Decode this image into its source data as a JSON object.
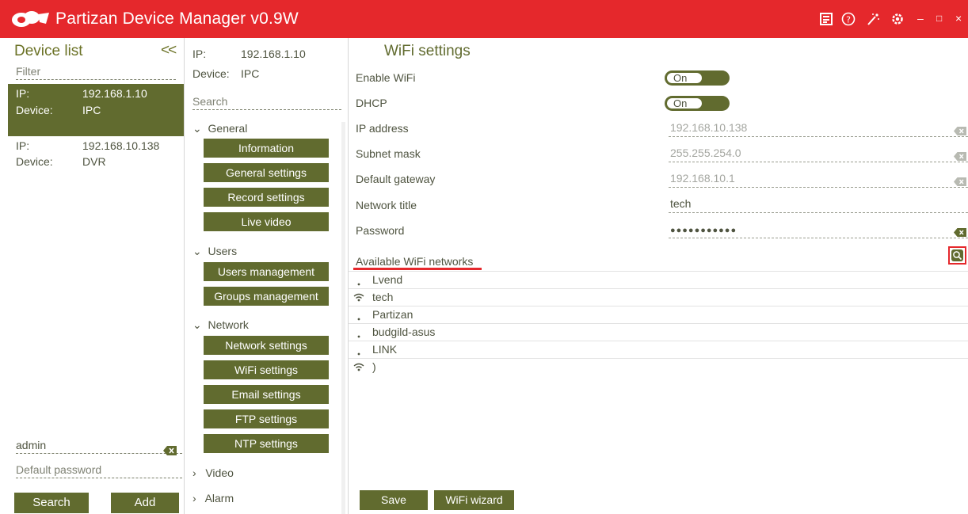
{
  "app": {
    "title": "Partizan Device Manager v0.9W",
    "brand_color": "#e5282c",
    "accent_color": "#616b2f",
    "titlebar_icons": [
      "book-icon",
      "help-icon",
      "wizard-wand-icon",
      "settings-gear-icon"
    ],
    "window_controls": [
      "minimize",
      "maximize",
      "close"
    ]
  },
  "device_list": {
    "title": "Device list",
    "collapse_glyph": "<<",
    "filter_placeholder": "Filter",
    "devices": [
      {
        "ip_label": "IP:",
        "ip": "192.168.1.10",
        "device_label": "Device:",
        "device": "IPC",
        "selected": true
      },
      {
        "ip_label": "IP:",
        "ip": "192.168.10.138",
        "device_label": "Device:",
        "device": "DVR",
        "selected": false
      }
    ],
    "username_value": "admin",
    "password_placeholder": "Default password",
    "search_button": "Search",
    "add_button": "Add"
  },
  "menu": {
    "ip_label": "IP:",
    "ip_value": "192.168.1.10",
    "device_label": "Device:",
    "device_value": "IPC",
    "search_placeholder": "Search",
    "sections": {
      "general": {
        "label": "General",
        "expanded": true,
        "items": [
          "Information",
          "General settings",
          "Record settings",
          "Live video"
        ]
      },
      "users": {
        "label": "Users",
        "expanded": true,
        "items": [
          "Users management",
          "Groups management"
        ]
      },
      "network": {
        "label": "Network",
        "expanded": true,
        "items": [
          "Network settings",
          "WiFi settings",
          "Email settings",
          "FTP settings",
          "NTP settings"
        ]
      },
      "video": {
        "label": "Video",
        "expanded": false
      },
      "alarm": {
        "label": "Alarm",
        "expanded": false
      }
    }
  },
  "wifi": {
    "title": "WiFi settings",
    "enable_wifi": {
      "label": "Enable WiFi",
      "toggle": "On"
    },
    "dhcp": {
      "label": "DHCP",
      "toggle": "On"
    },
    "ip_address": {
      "label": "IP address",
      "value": "192.168.10.138"
    },
    "subnet_mask": {
      "label": "Subnet mask",
      "value": "255.255.254.0"
    },
    "default_gateway": {
      "label": "Default gateway",
      "value": "192.168.10.1"
    },
    "network_title": {
      "label": "Network title",
      "value": "tech"
    },
    "password": {
      "label": "Password",
      "value": "●●●●●●●●●●●"
    },
    "available_label": "Available WiFi networks",
    "networks": [
      {
        "name": "Lvend",
        "signal": "dot"
      },
      {
        "name": "tech",
        "signal": "wifi"
      },
      {
        "name": "Partizan",
        "signal": "dot"
      },
      {
        "name": "budgild-asus",
        "signal": "dot"
      },
      {
        "name": "LINK",
        "signal": "dot"
      },
      {
        "name": ")",
        "signal": "wifi"
      }
    ],
    "save_button": "Save",
    "wizard_button": "WiFi wizard"
  }
}
